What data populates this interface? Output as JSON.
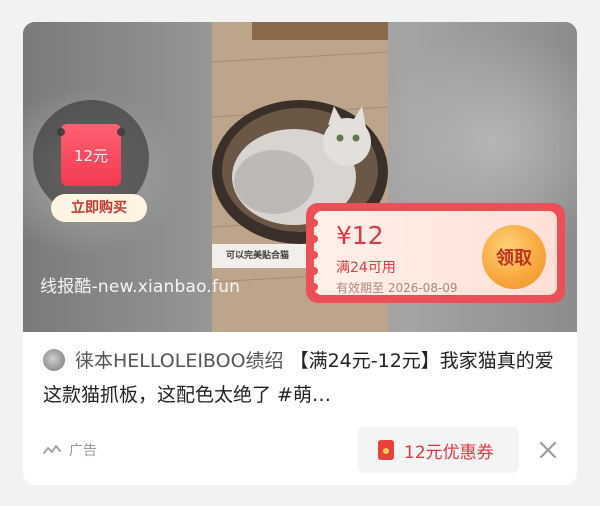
{
  "media": {
    "buy_badge": {
      "price": "12元",
      "button_label": "立即购买"
    },
    "watermark": "线报酷-new.xianbao.fun",
    "video_caption": "可以完美贴合猫",
    "coupon": {
      "price": "¥12",
      "condition": "满24可用",
      "validity": "有效期至 2026-08-09",
      "claim_label": "领取"
    }
  },
  "post": {
    "author": "徕本HELLOLEIBOO绩绍",
    "text": "【满24元-12元】我家猫真的爱这款猫抓板，这配色太绝了 #萌…"
  },
  "footer": {
    "ad_label": "广告",
    "coupon_label": "12元优惠券"
  },
  "icons": {
    "ad": "ad-signal-icon",
    "coupon": "red-packet-icon",
    "close": "close-icon"
  },
  "colors": {
    "accent_red": "#e23842",
    "coupon_frame": "#ec4f55",
    "claim_gold": "#f7a63a"
  }
}
